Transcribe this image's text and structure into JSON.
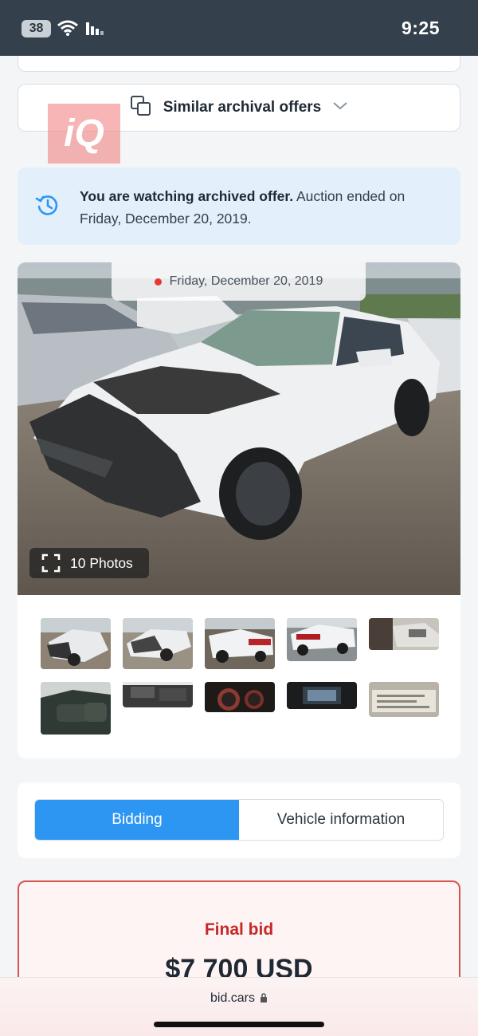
{
  "status_bar": {
    "battery": "38",
    "time": "9:25"
  },
  "similar_offers": {
    "label": "Similar archival offers",
    "icon": "copy-icon"
  },
  "watermark": {
    "logo_text": "iQ"
  },
  "notice": {
    "bold": "You are watching archived offer.",
    "rest": " Auction ended on Friday, December 20, 2019.",
    "icon": "history-icon"
  },
  "gallery": {
    "date": "Friday, December 20, 2019",
    "photos_label": "10 Photos",
    "thumbnails": [
      "front-left damage",
      "front damage",
      "rear-left",
      "rear",
      "interior door",
      "rear seats",
      "engine bay",
      "instrument cluster",
      "dashboard screen",
      "door label"
    ]
  },
  "tabs": {
    "bidding": "Bidding",
    "vehicle_information": "Vehicle information",
    "active": "bidding"
  },
  "final_bid": {
    "label": "Final bid",
    "value": "$7 700 USD"
  },
  "browser": {
    "url": "bid.cars"
  },
  "colors": {
    "accent": "#2d96f3",
    "final_bid_red": "#c62828",
    "notice_bg": "#e3f0fb",
    "status_bar": "#34414d"
  }
}
